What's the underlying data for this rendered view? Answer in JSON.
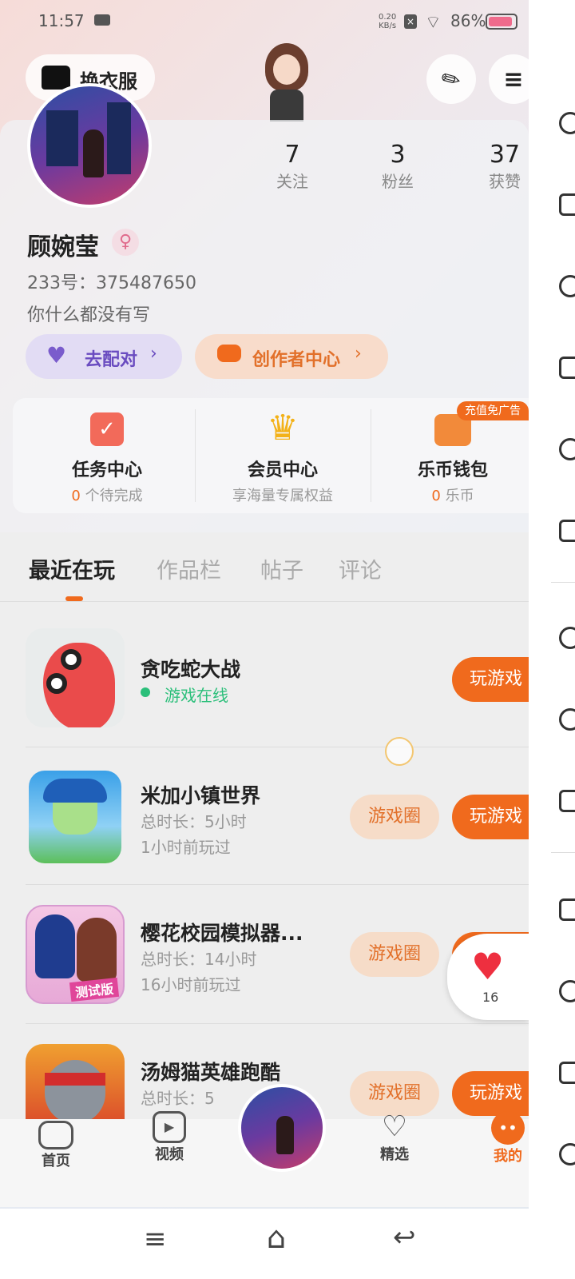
{
  "status_bar": {
    "time": "11:57",
    "net_speed_top": "0.20",
    "net_speed_bottom": "KB/s",
    "battery": "86%"
  },
  "header": {
    "outfit_label": "换衣服"
  },
  "profile": {
    "name": "顾婉莹",
    "id_line": "233号：375487650",
    "bio": "你什么都没有写",
    "stats": [
      {
        "value": "7",
        "label": "关注"
      },
      {
        "value": "3",
        "label": "粉丝"
      },
      {
        "value": "37",
        "label": "获赞"
      }
    ],
    "pair_btn": "去配对",
    "creator_btn": "创作者中心"
  },
  "services": [
    {
      "title": "任务中心",
      "sub_num": "0",
      "sub_text": "个待完成"
    },
    {
      "title": "会员中心",
      "sub_num": "",
      "sub_text": "享海量专属权益"
    },
    {
      "title": "乐币钱包",
      "sub_num": "0",
      "sub_text": "乐币",
      "badge": "充值免广告"
    }
  ],
  "tabs": [
    "最近在玩",
    "作品栏",
    "帖子",
    "评论"
  ],
  "games": [
    {
      "title": "贪吃蛇大战",
      "status": "游戏在线",
      "play": "玩游戏"
    },
    {
      "title": "米加小镇世界",
      "line1": "总时长：5小时",
      "line2": "1小时前玩过",
      "circle": "游戏圈",
      "play": "玩游戏"
    },
    {
      "title": "樱花校园模拟器...",
      "line1": "总时长：14小时",
      "line2": "16小时前玩过",
      "circle": "游戏圈",
      "play": "玩游戏",
      "tag": "测试版"
    },
    {
      "title": "汤姆猫英雄跑酷",
      "line1": "总时长：5",
      "circle": "游戏圈",
      "play": "玩游戏"
    }
  ],
  "like_float": {
    "count": "16"
  },
  "bottom_nav": [
    {
      "label": "首页"
    },
    {
      "label": "视频"
    },
    {
      "label": "精选"
    },
    {
      "label": "我的"
    }
  ],
  "colors": {
    "accent": "#f06a1d",
    "online": "#2bbf7a"
  }
}
